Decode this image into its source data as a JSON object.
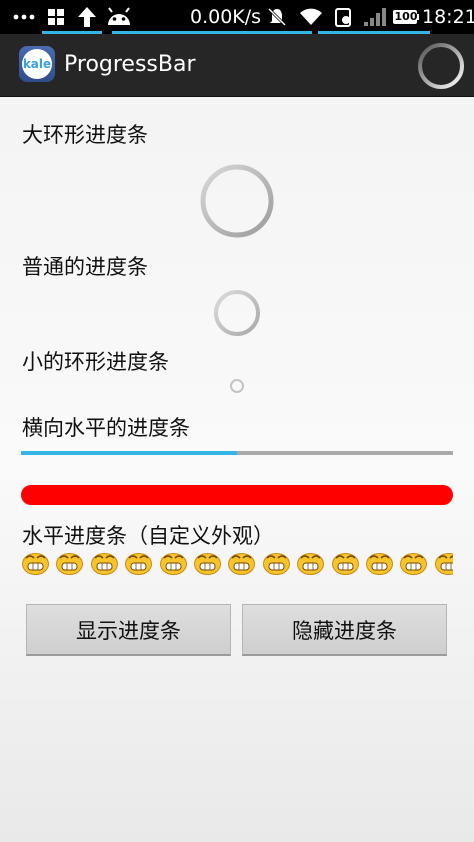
{
  "status_bar": {
    "network_speed": "0.00K/s",
    "battery_level": "100",
    "time": "18:21",
    "icons": [
      "more-dots-icon",
      "grid-icon",
      "upload-arrow-icon",
      "android-icon",
      "mute-bell-icon",
      "wifi-icon",
      "sim-icon",
      "signal-icon",
      "battery-icon"
    ]
  },
  "action_bar": {
    "app_icon_text": "kale",
    "title": "ProgressBar"
  },
  "content": {
    "large_spinner_label": "大环形进度条",
    "normal_spinner_label": "普通的进度条",
    "small_spinner_label": "小的环形进度条",
    "horizontal_label": "横向水平的进度条",
    "horizontal_progress": 0.5,
    "red_progress": 1.0,
    "custom_label": "水平进度条（自定义外观）",
    "custom_emoji_count": 13
  },
  "buttons": {
    "show_label": "显示进度条",
    "hide_label": "隐藏进度条"
  },
  "colors": {
    "accent": "#33b5e5",
    "red_bar": "#ff0000",
    "action_bar": "#262626"
  }
}
